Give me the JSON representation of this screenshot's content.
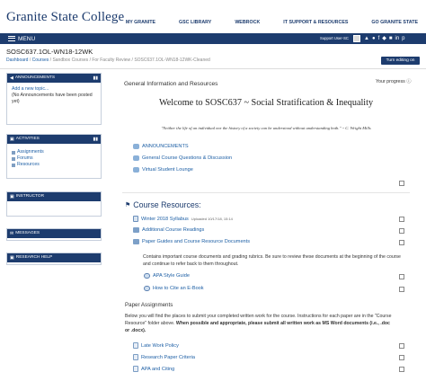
{
  "brand": {
    "logo": "Granite State College",
    "nav": [
      "MY GRANITE",
      "GSC LIBRARY",
      "WEBROCK",
      "IT SUPPORT & RESOURCES",
      "GO GRANITE STATE"
    ]
  },
  "menubar": {
    "menu_label": "MENU",
    "support_label": "Support User-SC",
    "icons": [
      "bell-icon",
      "chat-icon",
      "facebook-icon",
      "twitter-icon",
      "instagram-icon",
      "linkedin-icon",
      "pinterest-icon"
    ]
  },
  "header": {
    "course_title": "SOSC637.1OL-WN18-12WK",
    "breadcrumb": [
      "Dashboard",
      "Courses",
      "Sandbox Courses",
      "For Faculty Review",
      "SOSC637.1OL-WN18-12WK-Cleaned"
    ],
    "turn_editing": "Turn editing on"
  },
  "blocks": {
    "announcements": {
      "title": "ANNOUNCEMENTS",
      "add_topic": "Add a new topic...",
      "empty": "(No Announcements have been posted yet)"
    },
    "activities": {
      "title": "ACTIVITIES",
      "items": [
        "Assignments",
        "Forums",
        "Resources"
      ]
    },
    "instructor": {
      "title": "INSTRUCTOR"
    },
    "messages": {
      "title": "MESSAGES"
    },
    "research": {
      "title": "RESEARCH HELP"
    }
  },
  "main": {
    "progress": "Your progress",
    "general_heading": "General Information and Resources",
    "welcome": "Welcome to SOSC637 ~ Social Stratification & Inequality",
    "quote": "\"Neither the life of an individual nor the history of a society can be understood without understanding both.\" ~ C. Wright Mills",
    "general_items": [
      "ANNOUNCEMENTS",
      "General Course Questions & Discussion",
      "Virtual Student Lounge"
    ],
    "course_resources_heading": "Course Resources:",
    "resources": {
      "syllabus": "Winter 2018 Syllabus",
      "syllabus_meta": "Uploaded 10/17/18, 15:14",
      "additional": "Additional Course Readings",
      "guides": "Paper Guides and Course Resource Documents",
      "guides_desc": "Contains important course documents and grading rubrics.  Be sure to review these documents at the beginning of the course and continue to refer back to them throughout.",
      "apa": "APA Style Guide",
      "ebook": "How to Cite an E-Book"
    },
    "paper_heading": "Paper Assignments",
    "paper_desc_1": "Below you will find the places to submit your completed written work for the course. Instructions for each paper are in the \"Course Resource\" folder above. ",
    "paper_desc_2": "When possible and appropriate, please submit all written work as MS Word documents (i.e., .doc or .docx).",
    "paper_items": [
      "Late Work Policy",
      "Research Paper Criteria",
      "APA and Citing"
    ]
  },
  "colors": {
    "navy": "#1d3c6e",
    "link": "#1d5fa5"
  }
}
